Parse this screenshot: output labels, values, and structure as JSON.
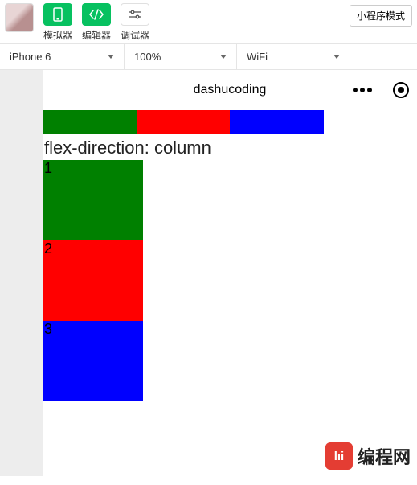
{
  "toolbar": {
    "simulator_label": "模拟器",
    "editor_label": "编辑器",
    "debugger_label": "调试器",
    "mode_button": "小程序模式"
  },
  "selectors": {
    "device": "iPhone 6",
    "zoom": "100%",
    "network": "WiFi"
  },
  "simulator": {
    "title": "dashucoding",
    "section_label": "flex-direction: column",
    "col_items": [
      "1",
      "2",
      "3"
    ]
  },
  "watermark": {
    "logo_text": "lıi",
    "text": "编程网"
  }
}
